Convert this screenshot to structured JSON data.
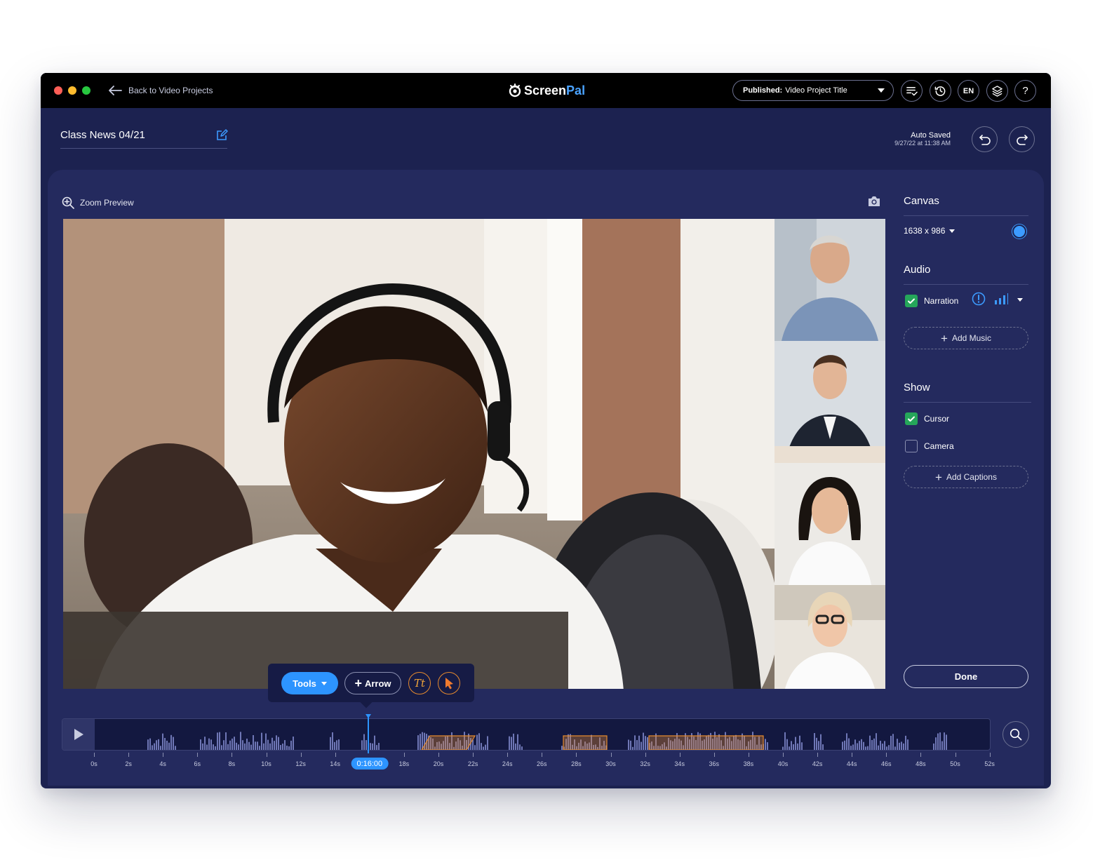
{
  "titlebar": {
    "back_label": "Back to Video Projects",
    "logo_a": "Screen",
    "logo_b": "Pal",
    "publish_prefix": "Published:",
    "publish_title": "Video Project Title",
    "lang_label": "EN",
    "help_label": "?"
  },
  "project": {
    "title": "Class News 04/21",
    "autosave_title": "Auto Saved",
    "autosave_time": "9/27/22 at 11:38 AM"
  },
  "preview": {
    "zoom_label": "Zoom Preview"
  },
  "sidebar": {
    "canvas_title": "Canvas",
    "canvas_size": "1638 x 986",
    "canvas_color": "#3c9bff",
    "audio_title": "Audio",
    "narration_label": "Narration",
    "narration_checked": true,
    "add_music_label": "Add Music",
    "show_title": "Show",
    "cursor_label": "Cursor",
    "cursor_checked": true,
    "camera_label": "Camera",
    "camera_checked": false,
    "add_captions_label": "Add Captions",
    "done_label": "Done"
  },
  "toolbar": {
    "tools_label": "Tools",
    "arrow_label": "Arrow",
    "text_tool_label": "Tt"
  },
  "timeline": {
    "current_time": "0:16:00",
    "tick_labels": [
      "0s",
      "2s",
      "4s",
      "6s",
      "8s",
      "10s",
      "12s",
      "14s",
      "16s",
      "18s",
      "20s",
      "22s",
      "24s",
      "26s",
      "28s",
      "30s",
      "32s",
      "34s",
      "36s",
      "38s",
      "40s",
      "42s",
      "44s",
      "46s",
      "48s",
      "50s",
      "52s"
    ],
    "accent_color": "#2d94ff",
    "segment_color": "#e58a2e"
  }
}
